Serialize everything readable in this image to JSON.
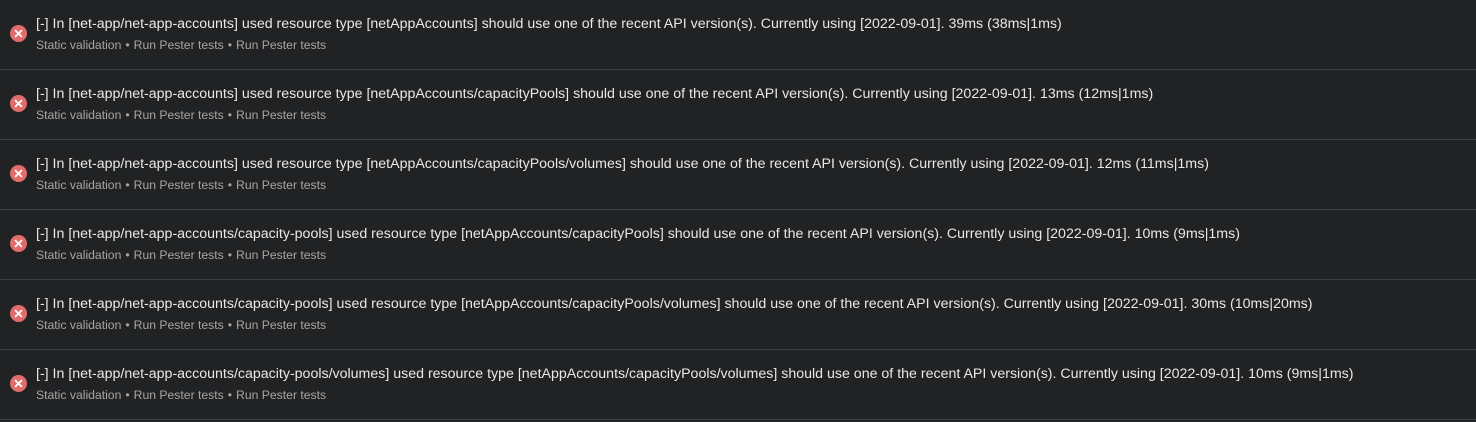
{
  "colors": {
    "background": "#212224",
    "divider": "#3c3d40",
    "error_icon": "#e06c6c",
    "message_text": "#e8e8e8",
    "meta_text": "#a6a6a6"
  },
  "results": [
    {
      "status_icon": "error-circle-icon",
      "message": "[-] In [net-app/net-app-accounts] used resource type [netAppAccounts] should use one of the recent API version(s). Currently using [2022-09-01]. 39ms (38ms|1ms)",
      "path": [
        "Static validation",
        "Run Pester tests",
        "Run Pester tests"
      ]
    },
    {
      "status_icon": "error-circle-icon",
      "message": "[-] In [net-app/net-app-accounts] used resource type [netAppAccounts/capacityPools] should use one of the recent API version(s). Currently using [2022-09-01]. 13ms (12ms|1ms)",
      "path": [
        "Static validation",
        "Run Pester tests",
        "Run Pester tests"
      ]
    },
    {
      "status_icon": "error-circle-icon",
      "message": "[-] In [net-app/net-app-accounts] used resource type [netAppAccounts/capacityPools/volumes] should use one of the recent API version(s). Currently using [2022-09-01]. 12ms (11ms|1ms)",
      "path": [
        "Static validation",
        "Run Pester tests",
        "Run Pester tests"
      ]
    },
    {
      "status_icon": "error-circle-icon",
      "message": "[-] In [net-app/net-app-accounts/capacity-pools] used resource type [netAppAccounts/capacityPools] should use one of the recent API version(s). Currently using [2022-09-01]. 10ms (9ms|1ms)",
      "path": [
        "Static validation",
        "Run Pester tests",
        "Run Pester tests"
      ]
    },
    {
      "status_icon": "error-circle-icon",
      "message": "[-] In [net-app/net-app-accounts/capacity-pools] used resource type [netAppAccounts/capacityPools/volumes] should use one of the recent API version(s). Currently using [2022-09-01]. 30ms (10ms|20ms)",
      "path": [
        "Static validation",
        "Run Pester tests",
        "Run Pester tests"
      ]
    },
    {
      "status_icon": "error-circle-icon",
      "message": "[-] In [net-app/net-app-accounts/capacity-pools/volumes] used resource type [netAppAccounts/capacityPools/volumes] should use one of the recent API version(s). Currently using [2022-09-01]. 10ms (9ms|1ms)",
      "path": [
        "Static validation",
        "Run Pester tests",
        "Run Pester tests"
      ]
    }
  ],
  "path_separator": "•"
}
